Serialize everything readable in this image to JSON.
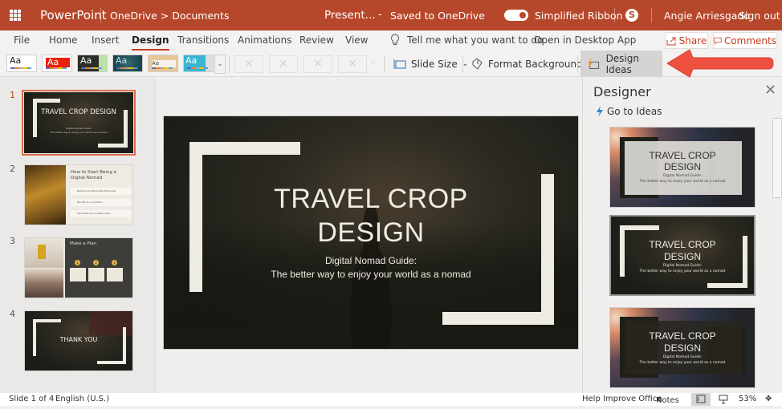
{
  "titlebar": {
    "app_name": "PowerPoint",
    "breadcrumb": "OneDrive > Documents",
    "document_name": "Present...",
    "dash": "-",
    "save_status": "Saved to OneDrive",
    "simplified_ribbon_label": "Simplified Ribbon",
    "simplified_ribbon_on": true,
    "skype_icon": "S",
    "user_name": "Angie Arriesgado",
    "sign_out": "Sign out",
    "accent_color": "#b7472a"
  },
  "tabs": [
    {
      "label": "File"
    },
    {
      "label": "Home"
    },
    {
      "label": "Insert"
    },
    {
      "label": "Design",
      "active": true
    },
    {
      "label": "Transitions"
    },
    {
      "label": "Animations"
    },
    {
      "label": "Review"
    },
    {
      "label": "View"
    }
  ],
  "tell_me": "Tell me what you want to do",
  "open_desktop": "Open in Desktop App",
  "share_label": "Share",
  "comments_label": "Comments",
  "ribbon": {
    "theme_sample": "Aa",
    "themes": [
      "Office Theme",
      "Red Theme",
      "Dark Green Theme",
      "Teal Theme",
      "Wood Theme",
      "Blue Theme"
    ],
    "slide_size": "Slide Size",
    "format_background": "Format Background",
    "design_ideas": "Design Ideas",
    "variant_icon": "✕"
  },
  "slides": [
    {
      "number": "1",
      "title": "TRAVEL CROP DESIGN",
      "subtitle": "Digital Nomad Guide:",
      "body": "The better way to enjoy your world as a nomad"
    },
    {
      "number": "2",
      "title": "How to Start Being a Digital Nomad",
      "items": [
        "Reduce and Eliminate Expenses",
        "Decide on a Location",
        "Set Goals and Create a Plan"
      ]
    },
    {
      "number": "3",
      "title": "Make a Plan",
      "steps": [
        "1",
        "2",
        "3"
      ]
    },
    {
      "number": "4",
      "title": "THANK YOU"
    }
  ],
  "current_slide": {
    "title_line1": "TRAVEL CROP",
    "title_line2": "DESIGN",
    "subtitle_line1": "Digital Nomad Guide:",
    "subtitle_line2": "The better way to enjoy your world as a nomad"
  },
  "designer": {
    "title": "Designer",
    "go_to_ideas": "Go to Ideas",
    "ideas": [
      {
        "title1": "TRAVEL CROP",
        "title2": "DESIGN",
        "sub1": "Digital Nomad Guide:",
        "sub2": "The better way to enjoy your world as a nomad"
      },
      {
        "title1": "TRAVEL CROP",
        "title2": "DESIGN",
        "sub1": "Digital Nomad Guide:",
        "sub2": "The better way to enjoy your world as a nomad"
      },
      {
        "title1": "TRAVEL CROP",
        "title2": "DESIGN",
        "sub1": "Digital Nomad Guide:",
        "sub2": "The better way to enjoy your world as a nomad"
      }
    ]
  },
  "statusbar": {
    "slide_position": "Slide 1 of 4",
    "language": "English (U.S.)",
    "help_improve": "Help Improve Office",
    "notes": "Notes",
    "zoom": "53%"
  }
}
